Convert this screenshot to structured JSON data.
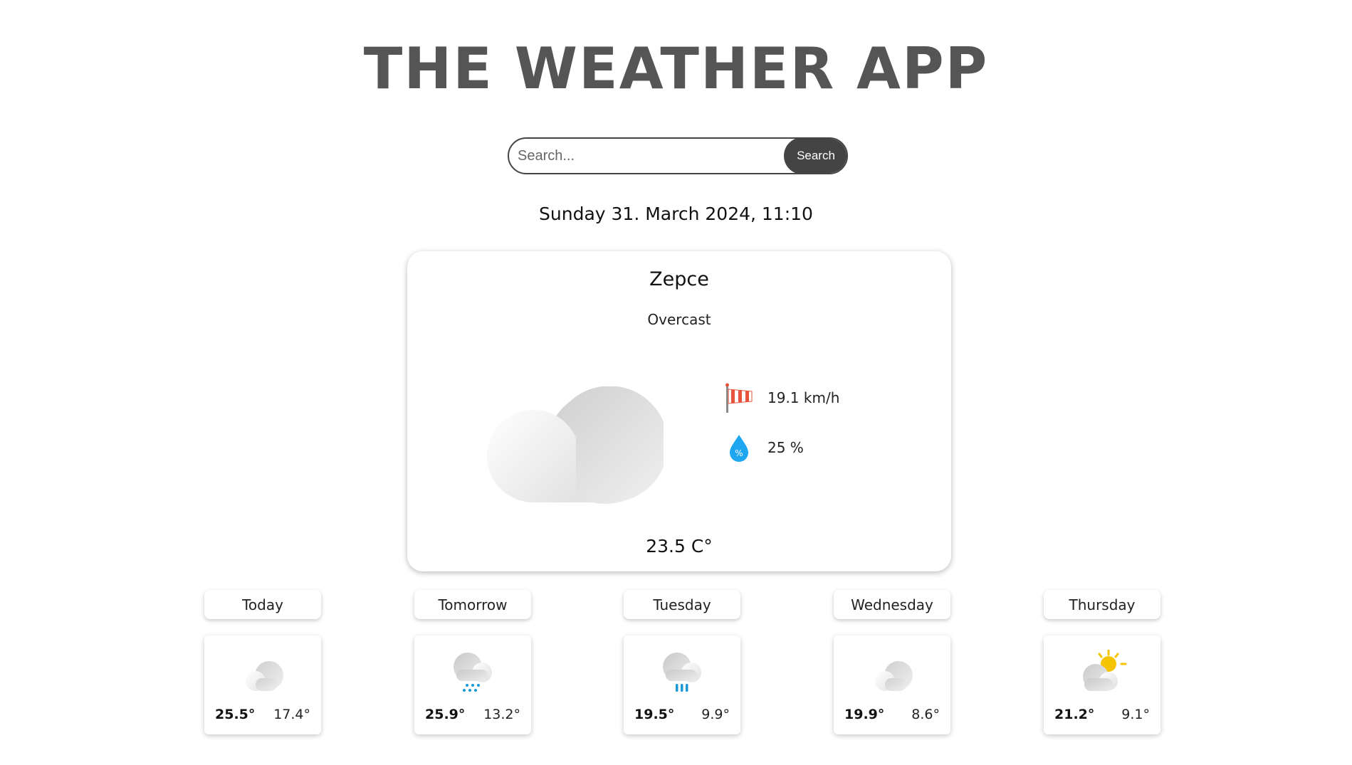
{
  "app": {
    "title": "THE WEATHER APP"
  },
  "search": {
    "placeholder": "Search...",
    "value": "",
    "button_label": "Search"
  },
  "datetime": "Sunday 31. March 2024, 11:10",
  "current": {
    "city": "Zepce",
    "condition": "Overcast",
    "icon": "overcast-cloud-icon",
    "wind": {
      "icon": "windsock-icon",
      "value": "19.1 km/h"
    },
    "humidity": {
      "icon": "humidity-drop-icon",
      "value": "25 %"
    },
    "temperature": "23.5 C°"
  },
  "forecast": [
    {
      "day": "Today",
      "icon": "cloudy-icon",
      "max": "25.5°",
      "min": "17.4°"
    },
    {
      "day": "Tomorrow",
      "icon": "cloud-drizzle-icon",
      "max": "25.9°",
      "min": "13.2°"
    },
    {
      "day": "Tuesday",
      "icon": "cloud-rain-icon",
      "max": "19.5°",
      "min": "9.9°"
    },
    {
      "day": "Wednesday",
      "icon": "cloudy-icon",
      "max": "19.9°",
      "min": "8.6°"
    },
    {
      "day": "Thursday",
      "icon": "partly-sunny-icon",
      "max": "21.2°",
      "min": "9.1°"
    }
  ],
  "colors": {
    "title": "#555555",
    "button_bg": "#444444",
    "wind_red": "#e8533c",
    "drop_blue": "#1ea6f0",
    "rain_blue": "#1c9ad6",
    "sun": "#f5c400"
  }
}
